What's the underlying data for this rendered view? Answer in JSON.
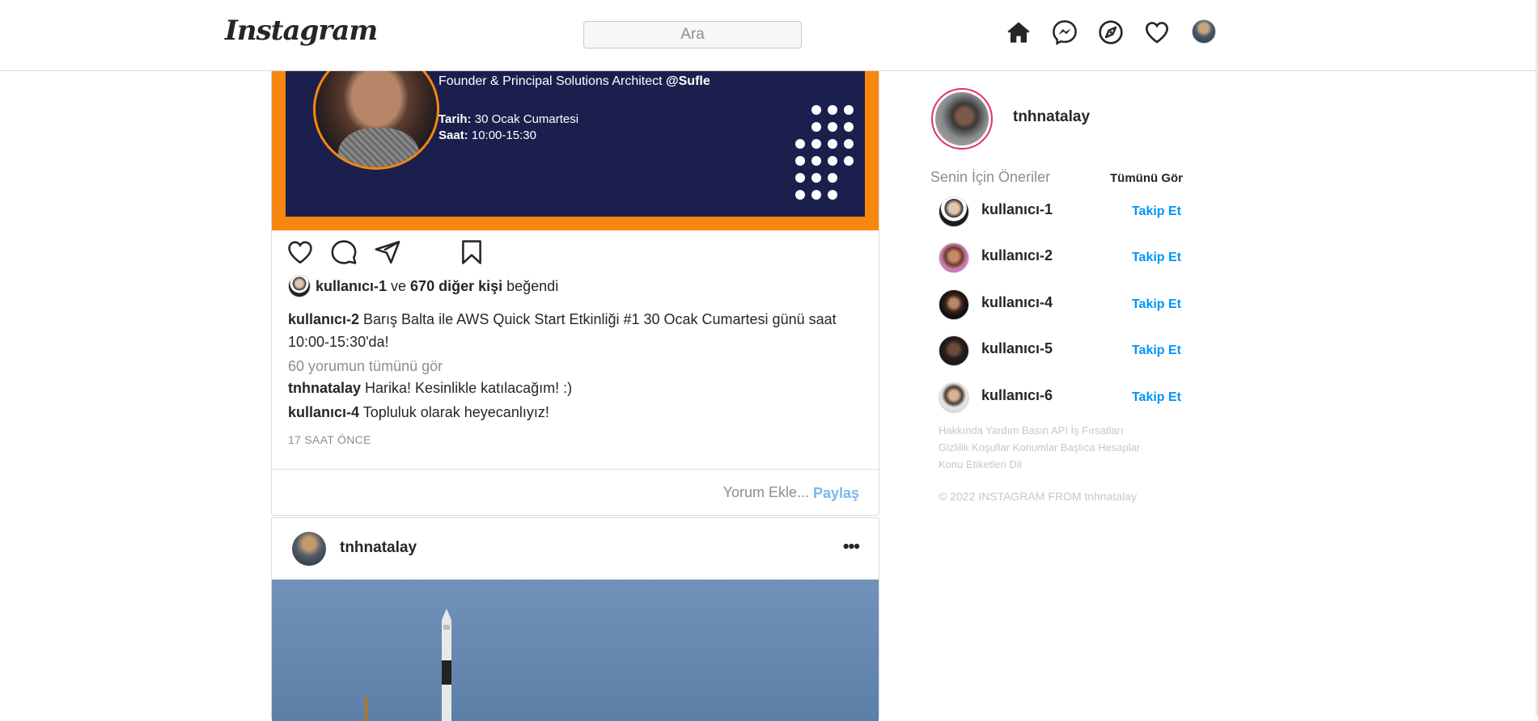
{
  "header": {
    "logo": "Instagram",
    "search_placeholder": "Ara",
    "icons": [
      "home-icon",
      "messenger-icon",
      "explore-icon",
      "heart-icon",
      "profile-avatar"
    ]
  },
  "post1": {
    "banner": {
      "subtitle_prefix": "Founder & Principal Solutions Architect ",
      "subtitle_handle": "@Sufle",
      "date_label": "Tarih:",
      "date_value": " 30 Ocak Cumartesi",
      "time_label": "Saat:",
      "time_value": " 10:00-15:30",
      "colors": {
        "frame": "#f7860f",
        "background": "#1b1f4e"
      }
    },
    "likes": {
      "user": "kullanıcı-1",
      "and": " ve ",
      "others": "670 diğer kişi",
      "suffix": " beğendi"
    },
    "caption": {
      "user": "kullanıcı-2",
      "text": " Barış Balta ile AWS Quick Start Etkinliği #1 30 Ocak Cumartesi günü saat  10:00-15:30'da!"
    },
    "view_all_comments": "60 yorumun tümünü gör",
    "comments": [
      {
        "user": "tnhnatalay",
        "text": " Harika! Kesinlikle katılacağım! :)"
      },
      {
        "user": "kullanıcı-4",
        "text": " Topluluk olarak heyecanlıyız!"
      }
    ],
    "time": "17 SAAT ÖNCE",
    "add_comment_placeholder": "Yorum Ekle...",
    "share_label": "Paylaş"
  },
  "post2": {
    "user": "tnhnatalay",
    "more": "•••"
  },
  "sidebar": {
    "username": "tnhnatalay",
    "suggestions_title": "Senin İçin Öneriler",
    "see_all": "Tümünü Gör",
    "suggestions": [
      {
        "name": "kullanıcı-1",
        "follow": "Takip Et"
      },
      {
        "name": "kullanıcı-2",
        "follow": "Takip Et"
      },
      {
        "name": "kullanıcı-4",
        "follow": "Takip Et"
      },
      {
        "name": "kullanıcı-5",
        "follow": "Takip Et"
      },
      {
        "name": "kullanıcı-6",
        "follow": "Takip Et"
      }
    ],
    "footer_links": "Hakkında Yardım Basın API İş Fırsatları Gizlilik Koşullar Konumlar Başlıca Hesaplar Konu Etiketleri Dil",
    "copyright": "© 2022 INSTAGRAM FROM tnhnatalay",
    "colors": {
      "follow": "#0095f6",
      "story_ring": "#e1306c"
    }
  }
}
